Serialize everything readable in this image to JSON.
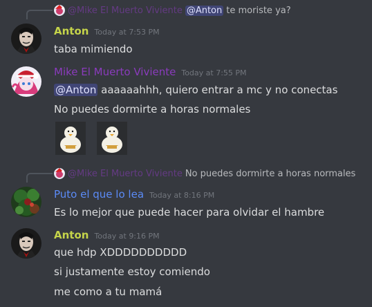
{
  "colors": {
    "mike": "#8a3bbc",
    "anton": "#c5d44a",
    "puto": "#5b8bf7",
    "mention_bg": "#474d8a",
    "bg": "#36393f"
  },
  "reply1": {
    "author": "@Mike El Muerto Viviente",
    "mention": "@Anton",
    "text": "te moriste ya?"
  },
  "msg1": {
    "username": "Anton",
    "timestamp": "Today at 7:53 PM",
    "lines": [
      "taba mimiendo"
    ]
  },
  "msg2": {
    "username": "Mike El Muerto Viviente",
    "timestamp": "Today at 7:55 PM",
    "mention": "@Anton",
    "line1_text": "aaaaaahhh, quiero entrar a mc y no conectas",
    "line2": "No puedes dormirte a horas normales",
    "stickers": [
      "duck-sticker",
      "duck-sticker"
    ]
  },
  "reply2": {
    "author": "@Mike El Muerto Viviente",
    "text": "No puedes dormirte a horas normales"
  },
  "msg3": {
    "username": "Puto el que lo lea",
    "timestamp": "Today at 8:16 PM",
    "lines": [
      "Es lo mejor que puede hacer para olvidar el hambre"
    ]
  },
  "msg4": {
    "username": "Anton",
    "timestamp": "Today at 9:16 PM",
    "lines": [
      "que hdp XDDDDDDDDDD",
      "si justamente estoy comiendo",
      "me como a tu mamá"
    ]
  }
}
